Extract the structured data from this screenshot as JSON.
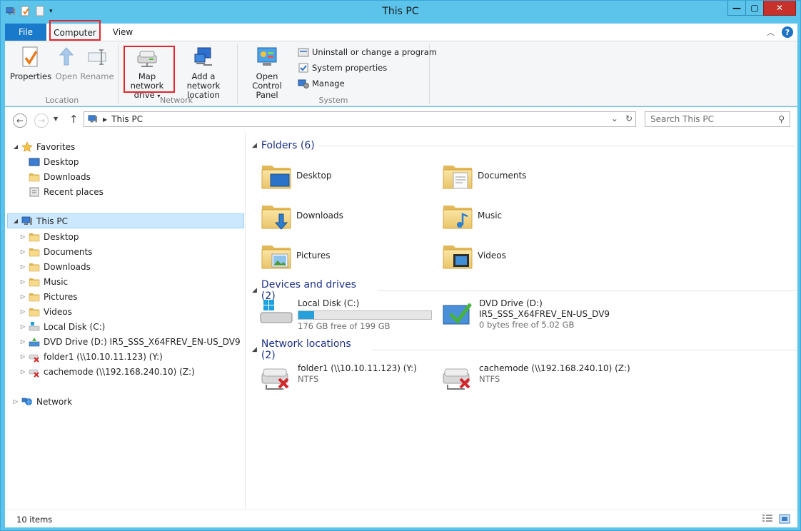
{
  "window": {
    "title": "This PC"
  },
  "ribbon_tabs": {
    "file": "File",
    "computer": "Computer",
    "view": "View"
  },
  "ribbon": {
    "location": {
      "label": "Location",
      "properties": "Properties",
      "open": "Open",
      "rename": "Rename"
    },
    "network": {
      "label": "Network",
      "map_line1": "Map network",
      "map_line2": "drive",
      "add_line1": "Add a network",
      "add_line2": "location"
    },
    "system": {
      "label": "System",
      "cp_line1": "Open Control",
      "cp_line2": "Panel",
      "uninstall": "Uninstall or change a program",
      "sysprops": "System properties",
      "manage": "Manage"
    }
  },
  "address": {
    "path": "This PC",
    "search_placeholder": "Search This PC"
  },
  "nav": {
    "favorites": "Favorites",
    "fav_items": [
      "Desktop",
      "Downloads",
      "Recent places"
    ],
    "this_pc": "This PC",
    "pc_items": [
      "Desktop",
      "Documents",
      "Downloads",
      "Music",
      "Pictures",
      "Videos",
      "Local Disk (C:)",
      "DVD Drive (D:) IR5_SSS_X64FREV_EN-US_DV9",
      "folder1 (\\\\10.10.11.123) (Y:)",
      "cachemode (\\\\192.168.240.10) (Z:)"
    ],
    "network": "Network"
  },
  "content": {
    "folders_title": "Folders (6)",
    "folders": [
      "Desktop",
      "Documents",
      "Downloads",
      "Music",
      "Pictures",
      "Videos"
    ],
    "devices_title": "Devices and drives (2)",
    "local_disk": {
      "name": "Local Disk (C:)",
      "free": "176 GB free of 199 GB",
      "used_fraction": 0.116
    },
    "dvd": {
      "name": "DVD Drive (D:)",
      "label": "IR5_SSS_X64FREV_EN-US_DV9",
      "free": "0 bytes free of 5.02 GB"
    },
    "network_title": "Network locations (2)",
    "net1": {
      "name": "folder1 (\\\\10.10.11.123) (Y:)",
      "fs": "NTFS"
    },
    "net2": {
      "name": "cachemode (\\\\192.168.240.10) (Z:)",
      "fs": "NTFS"
    }
  },
  "status": {
    "count": "10 items"
  },
  "colors": {
    "accent": "#1979ca",
    "highlight": "#e3262d",
    "chrome": "#5cc3ea",
    "progress": "#26a0da"
  }
}
